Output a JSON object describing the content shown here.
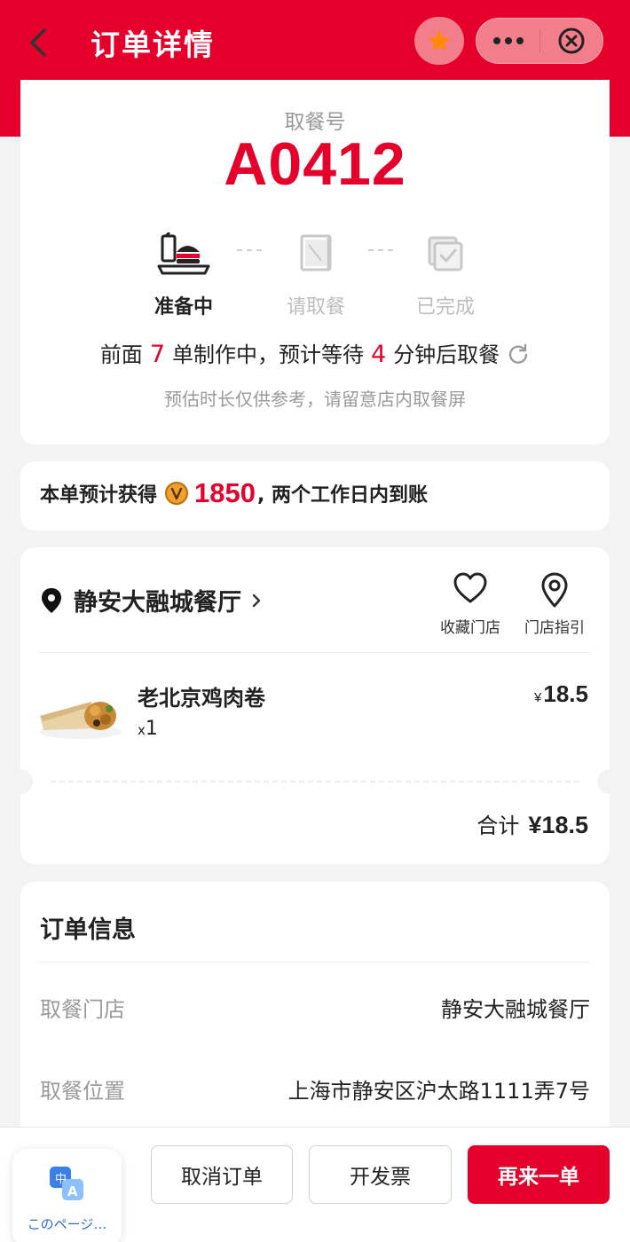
{
  "header": {
    "title": "订单详情"
  },
  "pickup": {
    "label": "取餐号",
    "number": "A0412",
    "steps": [
      {
        "label": "准备中",
        "icon": "burger-tray-icon",
        "active": true
      },
      {
        "label": "请取餐",
        "icon": "kfc-bag-icon",
        "active": false
      },
      {
        "label": "已完成",
        "icon": "completed-box-icon",
        "active": false
      }
    ],
    "wait": {
      "prefix": "前面",
      "orders_ahead": "7",
      "middle": "单制作中，预计等待",
      "minutes": "4",
      "suffix": "分钟后取餐"
    },
    "note": "预估时长仅供参考，请留意店内取餐屏"
  },
  "points": {
    "prefix": "本单预计获得",
    "amount": "1850",
    "suffix": ", 两个工作日内到账"
  },
  "store": {
    "name": "静安大融城餐厅",
    "favorite_label": "收藏门店",
    "guide_label": "门店指引",
    "item": {
      "name": "老北京鸡肉卷",
      "qty_prefix": "x",
      "qty": "1",
      "currency": "¥",
      "price": "18.5"
    },
    "total_label": "合计",
    "total": "¥18.5"
  },
  "order_info": {
    "title": "订单信息",
    "rows": [
      {
        "key": "取餐门店",
        "value": "静安大融城餐厅"
      },
      {
        "key": "取餐位置",
        "value": "上海市静安区沪太路1111弄7号"
      }
    ]
  },
  "footer": {
    "translate_label": "このページ…",
    "cancel_label": "取消订单",
    "invoice_label": "开发票",
    "reorder_label": "再来一单"
  },
  "colors": {
    "brand_red": "#e4002b"
  }
}
